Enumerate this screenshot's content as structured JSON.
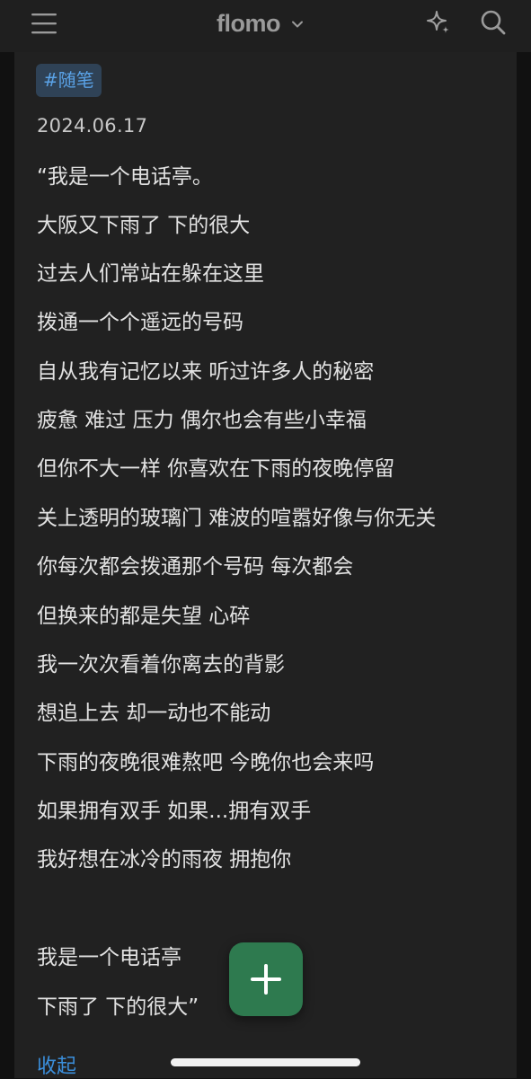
{
  "header": {
    "title": "flomo",
    "icons": {
      "menu": "menu-icon",
      "dropdown": "chevron-down-icon",
      "ai": "sparkle-icon",
      "search": "search-icon"
    }
  },
  "memo": {
    "tag": "#随笔",
    "date": "2024.06.17",
    "lines": [
      "“我是一个电话亭。",
      "大阪又下雨了 下的很大",
      "过去人们常站在躲在这里",
      "拨通一个个遥远的号码",
      "自从我有记忆以来 听过许多人的秘密",
      "疲惫 难过 压力 偶尔也会有些小幸福",
      "但你不大一样 你喜欢在下雨的夜晚停留",
      "关上透明的玻璃门 难波的喧嚣好像与你无关",
      "你每次都会拨通那个号码 每次都会",
      "但换来的都是失望 心碎",
      "我一次次看着你离去的背影",
      "想追上去 却一动也不能动",
      "下雨的夜晚很难熬吧 今晚你也会来吗",
      "如果拥有双手 如果...拥有双手",
      "我好想在冰冷的雨夜 拥抱你",
      "我是一个电话亭",
      "下雨了 下的很大”"
    ],
    "collapse_label": "收起"
  },
  "fab": {
    "icon": "plus-icon"
  },
  "colors": {
    "background": "#111111",
    "header": "#1f1f1f",
    "card": "#212121",
    "tag_bg": "#2f4256",
    "tag_text": "#5aa2e6",
    "link": "#3b8fdc",
    "fab": "#2e7a4f"
  }
}
